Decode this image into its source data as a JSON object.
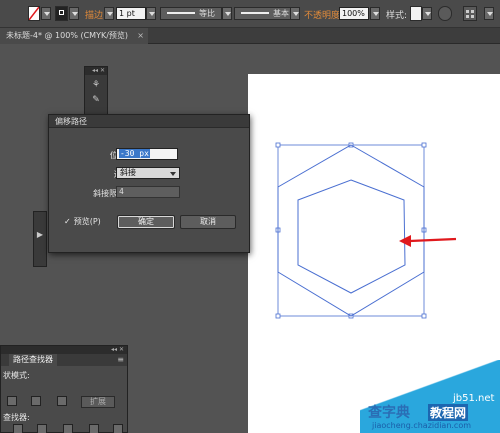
{
  "control_bar": {
    "stroke_label": "描边",
    "stroke_weight": "1 pt",
    "profile_label": "等比",
    "brush_label": "基本",
    "opacity_label": "不透明度",
    "opacity_value": "100%",
    "style_label": "样式:"
  },
  "document_tab": {
    "title": "未标题-4* @ 100% (CMYK/预览)",
    "close": "×"
  },
  "mini_panel": {
    "header": "◂◂ ✕"
  },
  "dialog": {
    "title": "偏移路径",
    "offset_label": "位移(O):",
    "offset_value": "-30 px",
    "join_label": "连接(J):",
    "join_value": "斜接",
    "miter_label": "斜接限制(M):",
    "miter_value": "4",
    "preview_label": "预览(P)",
    "preview_checked": true,
    "ok_label": "确定",
    "cancel_label": "取消"
  },
  "bottom_panel": {
    "header": "◂◂ ✕",
    "tab_label": "路径查找器",
    "menu": "≡",
    "shape_modes_label": "状模式:",
    "pathfinder_label": "查找器:",
    "expand_label": "扩展"
  },
  "watermark": {
    "line1": "查字典",
    "line2": "教程网",
    "line3": "jb51.net",
    "url": "jiaocheng.chazidian.com"
  },
  "colors": {
    "arrow": "#e0191d",
    "path": "#4a6fd1",
    "selection_highlight": "#3b78c9"
  }
}
